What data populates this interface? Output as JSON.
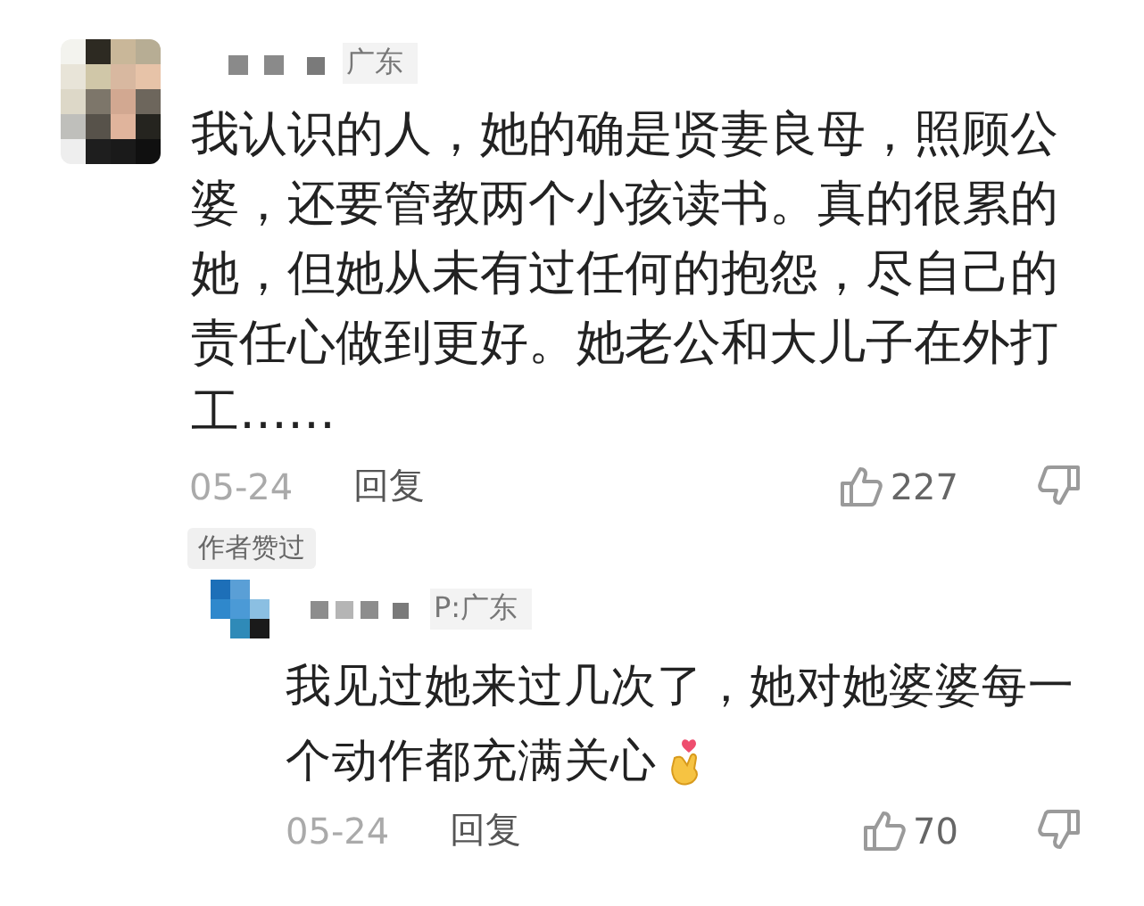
{
  "comments": [
    {
      "location": "广东",
      "text": "我认识的人，她的确是贤妻良母，照顾公婆，还要管教两个小孩读书。真的很累的她，但她从未有过任何的抱怨，尽自己的责任心做到更好。她老公和大儿子在外打工……",
      "date": "05-24",
      "reply_label": "回复",
      "likes": "227",
      "badge": "作者赞过",
      "replies": [
        {
          "location": "P:广东",
          "lines": [
            "我见过她来过几次了，她对她婆婆每一",
            "个动作都充满关心"
          ],
          "date": "05-24",
          "reply_label": "回复",
          "likes": "70"
        }
      ]
    }
  ]
}
